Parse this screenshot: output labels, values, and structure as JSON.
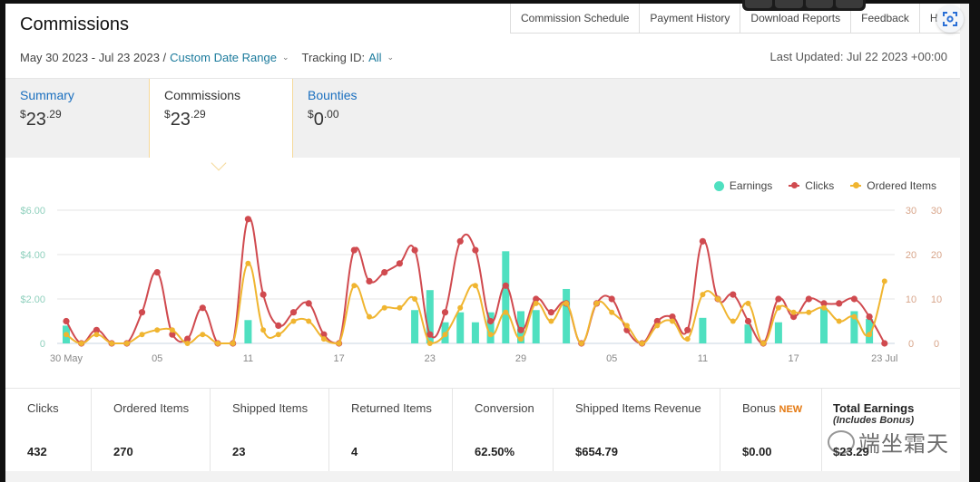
{
  "header": {
    "title": "Commissions",
    "nav": [
      "Commission Schedule",
      "Payment History",
      "Download Reports",
      "Feedback",
      "Help"
    ],
    "date_range": "May 30 2023 - Jul 23 2023 /",
    "date_range_link": "Custom Date Range",
    "tracking_label": "Tracking ID:",
    "tracking_value": "All",
    "last_updated": "Last Updated: Jul 22 2023 +00:00"
  },
  "tabs": [
    {
      "label": "Summary",
      "currency": "$",
      "whole": "23",
      "cents": ".29"
    },
    {
      "label": "Commissions",
      "currency": "$",
      "whole": "23",
      "cents": ".29"
    },
    {
      "label": "Bounties",
      "currency": "$",
      "whole": "0",
      "cents": ".00"
    }
  ],
  "stats": [
    {
      "label": "Clicks",
      "value": "432"
    },
    {
      "label": "Ordered Items",
      "value": "270"
    },
    {
      "label": "Shipped Items",
      "value": "23"
    },
    {
      "label": "Returned Items",
      "value": "4"
    },
    {
      "label": "Conversion",
      "value": "62.50%"
    },
    {
      "label": "Shipped Items Revenue",
      "value": "$654.79"
    },
    {
      "label": "Bonus",
      "badge": "NEW",
      "value": "$0.00"
    },
    {
      "label": "Total Earnings",
      "sub": "(Includes Bonus)",
      "value": "$23.29"
    }
  ],
  "watermark": "端坐霜天",
  "colors": {
    "earnings": "#4fe0c0",
    "clicks": "#d04a4f",
    "ordered": "#f0b530",
    "link": "#1a6fbf"
  },
  "chart_data": {
    "type": "line",
    "legend": [
      "Earnings",
      "Clicks",
      "Ordered Items"
    ],
    "legend_position": "top-right",
    "x_ticks": [
      "30 May",
      "05",
      "11",
      "17",
      "23",
      "29",
      "05",
      "11",
      "17",
      "23 Jul"
    ],
    "x_tick_index": [
      0,
      6,
      12,
      18,
      24,
      30,
      36,
      42,
      48,
      54
    ],
    "y_left_ticks": [
      "0",
      "$2.00",
      "$4.00",
      "$6.00"
    ],
    "y_left_range": [
      0,
      6
    ],
    "y_right_ticks": [
      "0",
      "10",
      "20",
      "30"
    ],
    "y_right_range": [
      0,
      30
    ],
    "series": [
      {
        "name": "Earnings",
        "type": "bar",
        "axis": "left",
        "values": [
          0.8,
          0,
          0,
          0,
          0,
          0,
          0,
          0,
          0,
          0,
          0,
          0,
          1.05,
          0,
          0,
          0,
          0,
          0,
          0,
          0,
          0,
          0,
          0,
          1.5,
          2.4,
          0.95,
          1.4,
          0.95,
          1.4,
          4.15,
          1.45,
          1.5,
          0,
          2.45,
          0,
          0,
          0,
          0,
          0,
          0,
          0,
          0,
          1.15,
          0,
          0,
          0.85,
          0,
          0.95,
          0,
          0,
          1.6,
          0,
          1.45,
          1.1,
          0
        ]
      },
      {
        "name": "Clicks",
        "type": "line",
        "axis": "right",
        "values": [
          5,
          0,
          3,
          0,
          0,
          7,
          16,
          2,
          1,
          8,
          0,
          0,
          28,
          11,
          4,
          7,
          9,
          2,
          0,
          21,
          14,
          16,
          18,
          21,
          2,
          7,
          23,
          21,
          5,
          13,
          3,
          10,
          7,
          9,
          0,
          9,
          10,
          3,
          0,
          5,
          6,
          3,
          23,
          10,
          11,
          5,
          0,
          10,
          6,
          10,
          9,
          9,
          10,
          6,
          0
        ]
      },
      {
        "name": "Ordered Items",
        "type": "line",
        "axis": "right",
        "values": [
          2,
          0,
          2,
          0,
          0,
          2,
          3,
          3,
          0,
          2,
          0,
          0,
          18,
          3,
          2,
          5,
          5,
          1,
          0,
          13,
          6,
          8,
          8,
          10,
          0,
          2,
          8,
          13,
          2,
          7,
          1,
          9,
          5,
          9,
          0,
          9,
          7,
          4,
          0,
          4,
          5,
          1,
          11,
          10,
          5,
          9,
          0,
          8,
          7,
          7,
          8,
          5,
          6,
          2,
          14
        ]
      }
    ]
  }
}
